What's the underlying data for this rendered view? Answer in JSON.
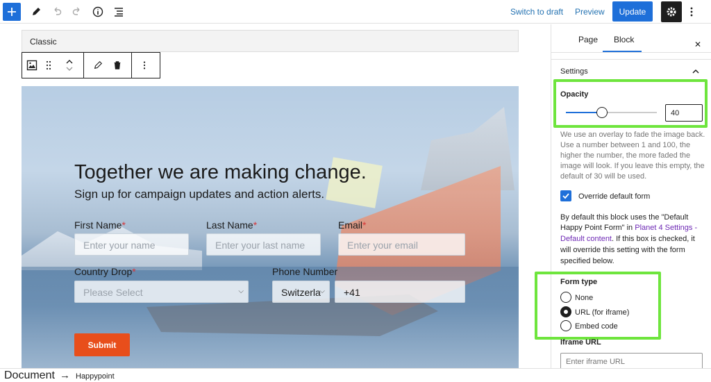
{
  "topbar": {
    "switch_to_draft": "Switch to draft",
    "preview": "Preview",
    "update": "Update"
  },
  "editor": {
    "classic_label": "Classic"
  },
  "form": {
    "title": "Together we are making change.",
    "subtitle": "Sign up for campaign updates and action alerts.",
    "first_name_label": "First Name",
    "first_name_placeholder": "Enter your name",
    "last_name_label": "Last Name",
    "last_name_placeholder": "Enter your last name",
    "email_label": "Email",
    "email_placeholder": "Enter your email",
    "country_label": "Country Drop",
    "country_placeholder": "Please Select",
    "phone_label": "Phone Number",
    "phone_country": "Switzerla",
    "phone_code": "+41",
    "required_mark": "*",
    "submit": "Submit"
  },
  "sidebar": {
    "tab_page": "Page",
    "tab_block": "Block",
    "close": "✕",
    "settings_title": "Settings",
    "opacity_label": "Opacity",
    "opacity_value": "40",
    "opacity_fraction": 0.4,
    "opacity_help_1": "We use an overlay to fade the image back.",
    "opacity_help_2": "Use a number between 1 and 100, the",
    "opacity_help_3": "higher the number, the more faded the",
    "opacity_help_4": "image will look. If you leave this empty, the",
    "opacity_help_5": "default of 30 will be used.",
    "override_label": "Override default form",
    "override_help_1": "By default this block uses the \"Default",
    "override_help_2a": "Happy Point Form\" in ",
    "override_help_2b": "Planet 4 Settings -",
    "override_help_3a": "Default content",
    "override_help_3b": ". If this box is checked, it",
    "override_help_4": "will override this setting with the form",
    "override_help_5": "specified below.",
    "form_type_label": "Form type",
    "radio_none": "None",
    "radio_url": "URL (for iframe)",
    "radio_embed": "Embed code",
    "iframe_url_label": "Iframe URL",
    "iframe_url_placeholder": "Enter iframe URL"
  },
  "footer": {
    "document": "Document",
    "arrow": "→",
    "block": "Happypoint"
  },
  "colors": {
    "accent": "#1e6fd9",
    "highlight": "#6ee53d",
    "submit": "#e84e1b"
  }
}
